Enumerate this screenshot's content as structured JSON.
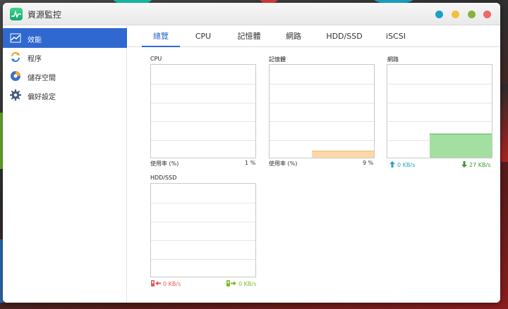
{
  "window": {
    "title": "資源監控"
  },
  "sidebar": {
    "items": [
      {
        "label": "效能",
        "icon": "performance-chart-icon",
        "active": true
      },
      {
        "label": "程序",
        "icon": "process-cycle-icon",
        "active": false
      },
      {
        "label": "儲存空間",
        "icon": "storage-disk-icon",
        "active": false
      },
      {
        "label": "偏好設定",
        "icon": "gear-icon",
        "active": false
      }
    ]
  },
  "tabs": [
    {
      "label": "總覽",
      "active": true
    },
    {
      "label": "CPU",
      "active": false
    },
    {
      "label": "記憶體",
      "active": false
    },
    {
      "label": "網路",
      "active": false
    },
    {
      "label": "HDD/SSD",
      "active": false
    },
    {
      "label": "iSCSI",
      "active": false
    }
  ],
  "panels": {
    "cpu": {
      "title": "CPU",
      "usage_label": "使用率 (%)",
      "value": "1 %",
      "level_pct": 1
    },
    "memory": {
      "title": "記憶體",
      "usage_label": "使用率 (%)",
      "value": "9 %",
      "level_pct": 9
    },
    "network": {
      "title": "網路",
      "upload": "0 KB/s",
      "download": "27 KB/s",
      "level_pct": 27
    },
    "disk": {
      "title": "HDD/SSD",
      "read": "0 KB/s",
      "write": "0 KB/s",
      "level_pct": 0
    }
  },
  "colors": {
    "accent": "#2f69cf",
    "cpu_fill": "#2f7fe0",
    "memory_fill": "#fdd8a8",
    "memory_line": "#f0b878",
    "network_fill": "#a3dfa0",
    "network_line": "#5ab85a",
    "disk_line": "#e8a0a0",
    "close": "#ec6a6a",
    "maximize": "#86b43a",
    "minimize": "#f2c03a",
    "info": "#1aa0c8"
  }
}
